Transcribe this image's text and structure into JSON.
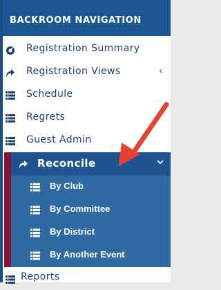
{
  "header": {
    "title": "BACKROOM NAVIGATION"
  },
  "nav": {
    "items": [
      {
        "label": "Registration Summary",
        "icon": "dashboard-icon"
      },
      {
        "label": "Registration Views",
        "icon": "share-icon",
        "chevron": "‹"
      },
      {
        "label": "Schedule",
        "icon": "list-icon"
      },
      {
        "label": "Regrets",
        "icon": "list-icon"
      },
      {
        "label": "Guest Admin",
        "icon": "list-icon"
      }
    ],
    "reconcile": {
      "label": "Reconcile",
      "icon": "share-icon",
      "expanded": true,
      "subitems": [
        {
          "label": "By Club",
          "icon": "list-icon"
        },
        {
          "label": "By Committee",
          "icon": "list-icon"
        },
        {
          "label": "By District",
          "icon": "list-icon"
        },
        {
          "label": "By Another Event",
          "icon": "list-icon"
        }
      ]
    },
    "after": [
      {
        "label": "Reports",
        "icon": "list-icon"
      }
    ]
  },
  "colors": {
    "header_bg": "#1c5693",
    "text": "#1b3f6e",
    "active_bg": "#1f5491",
    "sub_bg": "#2f6aa3",
    "accent_stripe": "#8a1436",
    "annotation_arrow": "#e8412f"
  }
}
